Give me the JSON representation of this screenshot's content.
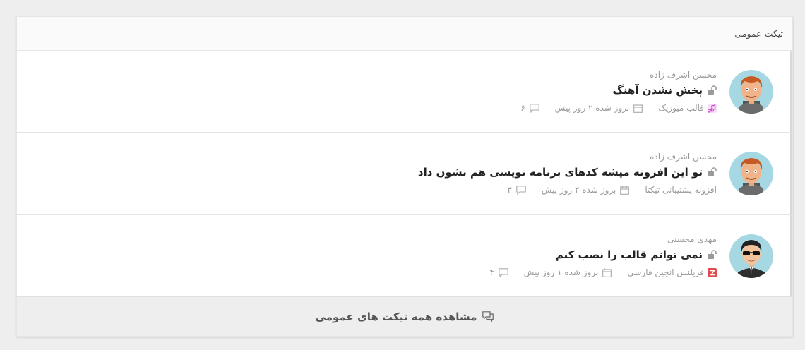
{
  "panel": {
    "title": "تیکت عمومی"
  },
  "tickets": [
    {
      "author": "محسن اشرف زاده",
      "title": "پخش نشدن آهنگ",
      "product": "قالب میوزیک",
      "product_icon": "music-template-icon",
      "updated": "بروز شده ۲ روز پیش",
      "comments": "۶",
      "avatar": "avatar-orange-hair"
    },
    {
      "author": "محسن اشرف زاده",
      "title": "تو این افزونه میشه کدهای برنامه نویسی هم نشون داد",
      "product": "افزونه پشتیبانی تیکتا",
      "product_icon": "",
      "updated": "بروز شده ۲ روز پیش",
      "comments": "۳",
      "avatar": "avatar-orange-hair"
    },
    {
      "author": "مهدی محسنی",
      "title": "نمی توانم قالب را نصب کنم",
      "product": "فریلنس انجین فارسی",
      "product_icon": "freelance-engine-icon",
      "updated": "بروز شده ۱ روز پیش",
      "comments": "۴",
      "avatar": "avatar-sunglasses"
    }
  ],
  "footer": {
    "label": "مشاهده همه تیکت های عمومی"
  },
  "colors": {
    "accent_music": "#d04bd0",
    "accent_freelance": "#e24b4b",
    "avatar_bg": "#a6d8e3"
  }
}
